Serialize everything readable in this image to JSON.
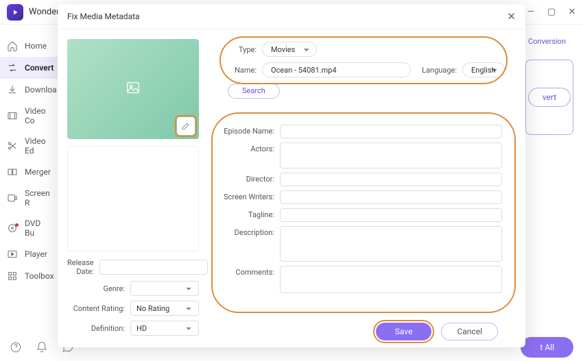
{
  "app": {
    "name": "Wonder"
  },
  "window": {
    "minimize": "—",
    "maximize": "▢",
    "close": "✕"
  },
  "sidebar": {
    "items": [
      {
        "label": "Home"
      },
      {
        "label": "Convert"
      },
      {
        "label": "Downloa"
      },
      {
        "label": "Video Co"
      },
      {
        "label": "Video Ed"
      },
      {
        "label": "Merger"
      },
      {
        "label": "Screen R"
      },
      {
        "label": "DVD Bu"
      },
      {
        "label": "Player"
      },
      {
        "label": "Toolbox"
      }
    ]
  },
  "right_bg": {
    "tab": "Conversion",
    "convert_btn": "vert",
    "convert_all": "t All"
  },
  "modal": {
    "title": "Fix Media Metadata",
    "top": {
      "type_label": "Type:",
      "type_value": "Movies",
      "name_label": "Name:",
      "name_value": "Ocean - 54081.mp4",
      "lang_label": "Language:",
      "lang_value": "English",
      "search": "Search"
    },
    "left": {
      "release_label": "Release Date:",
      "release_value": "",
      "genre_label": "Genre:",
      "genre_value": "",
      "rating_label": "Content Rating:",
      "rating_value": "No Rating",
      "definition_label": "Definition:",
      "definition_value": "HD"
    },
    "details": {
      "episode_label": "Episode Name:",
      "actors_label": "Actors:",
      "director_label": "Director:",
      "writers_label": "Screen Writers:",
      "tagline_label": "Tagline:",
      "description_label": "Description:",
      "comments_label": "Comments:"
    },
    "footer": {
      "save": "Save",
      "cancel": "Cancel"
    }
  }
}
